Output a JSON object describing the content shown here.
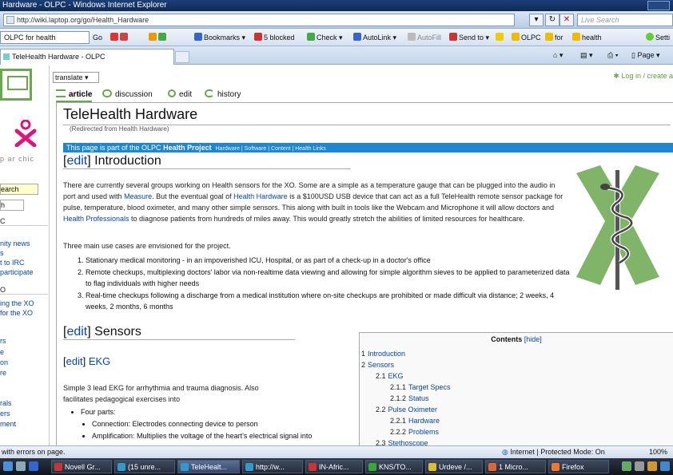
{
  "window": {
    "title": "Hardware - OLPC - Windows Internet Explorer"
  },
  "address": {
    "url": "http://wiki.laptop.org/go/Health_Hardware",
    "search_placeholder": "Live Search"
  },
  "linkbar": {
    "search_value": "OLPC for health",
    "go_label": "Go",
    "items": [
      "Bookmarks",
      "5 blocked",
      "Check",
      "AutoLink",
      "AutoFill",
      "Send to",
      "OLPC",
      "for",
      "health",
      "Setti"
    ]
  },
  "tabbar": {
    "tab_label": "TeleHealth Hardware - OLPC",
    "page_menu": "Page"
  },
  "sidebar": {
    "motto": "p ar chic",
    "search_label": "earch",
    "go_label": "h",
    "section1": "C",
    "links1": [
      "nity news",
      "s",
      "t to IRC",
      "participate"
    ],
    "section2": "O",
    "links2": [
      "ing the XO",
      "for the XO"
    ],
    "links3": [
      "rs",
      "e",
      "on",
      "re"
    ],
    "links4": [
      "rals",
      "ers",
      "ment"
    ]
  },
  "actions": {
    "language": "translate",
    "login": "Log in / create a",
    "article": "article",
    "discussion": "discussion",
    "edit": "edit",
    "history": "history"
  },
  "article": {
    "title": "TeleHealth Hardware",
    "redirect": "(Redirected from Health Hardware)",
    "project_prefix": "This page is part of the OLPC",
    "project_name": "Health Project",
    "project_links": "Hardware | Software | Content | Health Links",
    "edit_label": "edit",
    "intro_heading": "Introduction",
    "intro_p1_a": "There are currently several groups working on Health sensors for the XO. Some are a simple as a temperature gauge that can be plugged into the audio in port and used with ",
    "intro_link_measure": "Measure",
    "intro_p1_b": ". But the eventual goal of ",
    "intro_link_hh": "Health Hardware",
    "intro_p1_c": " is a $100USD USB device that can act as a full TeleHealth remote sensor package for pulse, temperature, blood oximeter, and many other simple sensors. This along with built in tools like the Webcam and Microphone it will allow doctors and ",
    "intro_link_hp": "Health Professionals",
    "intro_p1_d": " to diagnose patients from hundreds of miles away. This would greatly stretch the abilities of limited resources for healthcare.",
    "intro_p2": "Three main use cases are envisioned for the project.",
    "uses": [
      "Stationary medical monitoring - in an impoverished ICU, Hospital, or as part of a check-up in a doctor's office",
      "Remote checkups, multiplexing doctors' labor via non-realtime data viewing and allowing for simple algorithm sieves to be applied to parameterized data to flag individuals with higher needs",
      "Real-time checkups following a discharge from a medical institution where on-site checkups are prohibited or made difficult via distance; 2 weeks, 4 weeks, 2 months, 6 months"
    ],
    "sensors_heading": "Sensors",
    "ekg_heading": "EKG",
    "ekg_p": "Simple 3 lead EKG for arrhythmia and trauma diagnosis. Also facilitates pedagogical exercises into",
    "parts_label": "Four parts:",
    "parts": [
      "Connection: Electrodes connecting device to person",
      "Amplification: Multiplies the voltage of the heart's electrical signal into"
    ]
  },
  "toc": {
    "title": "Contents",
    "hide": "[hide]",
    "items": [
      {
        "num": "1",
        "label": "Introduction"
      },
      {
        "num": "2",
        "label": "Sensors"
      },
      {
        "num": "2.1",
        "label": "EKG"
      },
      {
        "num": "2.1.1",
        "label": "Target Specs"
      },
      {
        "num": "2.1.2",
        "label": "Status"
      },
      {
        "num": "2.2",
        "label": "Pulse Oximeter"
      },
      {
        "num": "2.2.1",
        "label": "Hardware"
      },
      {
        "num": "2.2.2",
        "label": "Problems"
      },
      {
        "num": "2.3",
        "label": "Stethoscope"
      }
    ]
  },
  "statusbar": {
    "left": "with errors on page.",
    "zone": "Internet | Protected Mode: On",
    "zoom": "100%"
  },
  "taskbar": {
    "items": [
      "Novell Gr...",
      "(15 unre...",
      "TeleHealt...",
      "http://w...",
      "IN-Afric...",
      "KNS/TO...",
      "Urdeve /...",
      "1 Micro...",
      "Firefox"
    ]
  },
  "colors": {
    "olpc_green": "#6aa84f",
    "xo_pink": "#e0157a",
    "project_blue": "#1c88d4",
    "link": "#0645ad"
  }
}
